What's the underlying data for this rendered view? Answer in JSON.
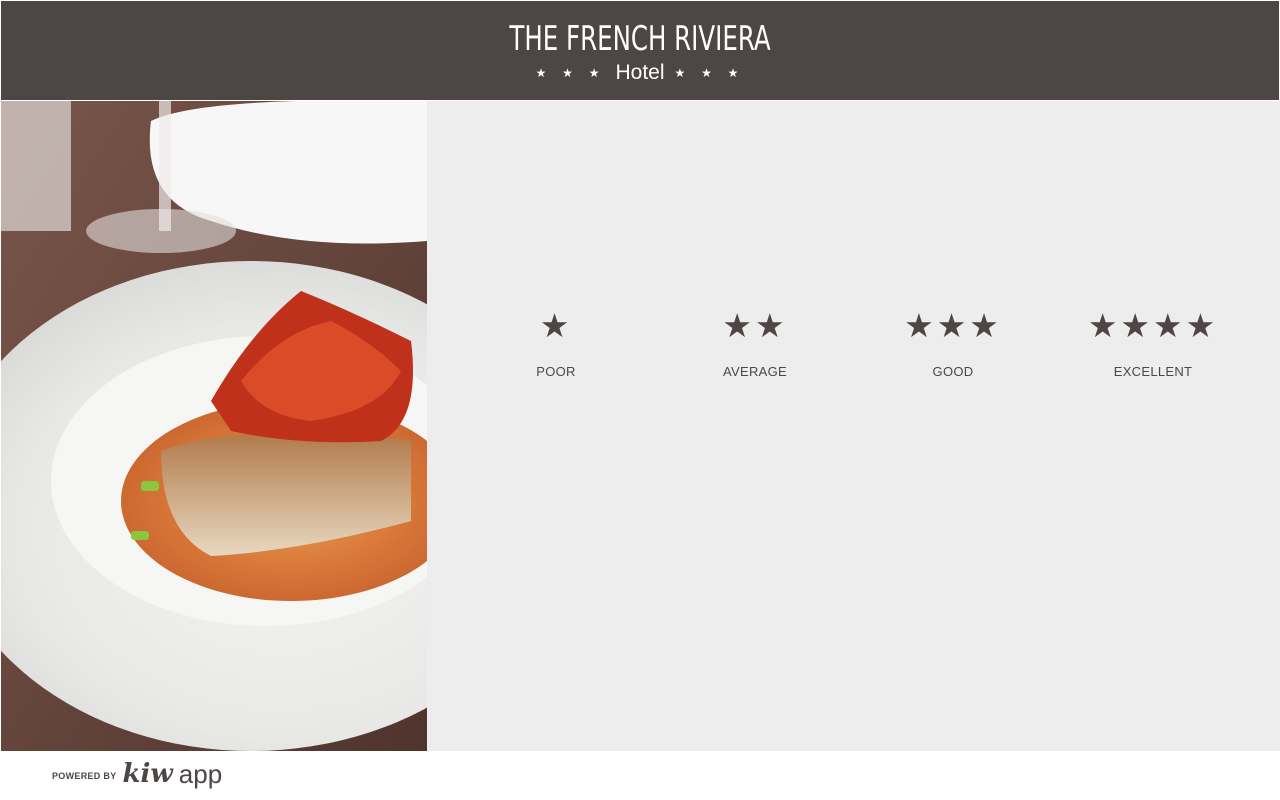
{
  "header": {
    "title": "THE FRENCH RIVIERA",
    "subtitle": "Hotel",
    "stars_left": "★ ★ ★",
    "stars_right": "★ ★ ★"
  },
  "ratings": [
    {
      "stars": "★",
      "label": "POOR",
      "value": 1
    },
    {
      "stars": "★★",
      "label": "AVERAGE",
      "value": 2
    },
    {
      "stars": "★★★",
      "label": "GOOD",
      "value": 3
    },
    {
      "stars": "★★★★",
      "label": "EXCELLENT",
      "value": 4
    }
  ],
  "footer": {
    "powered_by": "POWERED BY",
    "brand_kiw": "kiw",
    "brand_app": "app"
  },
  "colors": {
    "header_bg": "#4e4644",
    "panel_bg": "#ededed",
    "star_color": "#4e4644"
  },
  "icons": {
    "rating_star": "star-icon",
    "photo": "food-photo"
  }
}
